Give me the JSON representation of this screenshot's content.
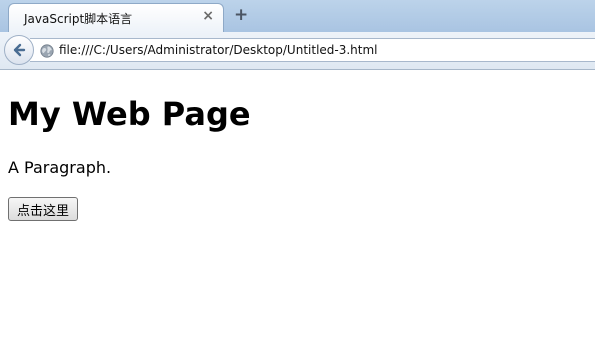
{
  "browser": {
    "tab": {
      "title": "JavaScript脚本语言",
      "close_icon": "close-icon"
    },
    "new_tab_icon": "plus-icon",
    "nav": {
      "back_icon": "back-arrow-icon",
      "site_icon": "globe-icon",
      "url": "file:///C:/Users/Administrator/Desktop/Untitled-3.html"
    }
  },
  "page": {
    "heading": "My Web Page",
    "paragraph": "A Paragraph.",
    "button_label": "点击这里"
  },
  "colors": {
    "tabstrip": "#a9c4e2",
    "toolbar": "#e6edf5",
    "page_background": "#ffffff"
  }
}
